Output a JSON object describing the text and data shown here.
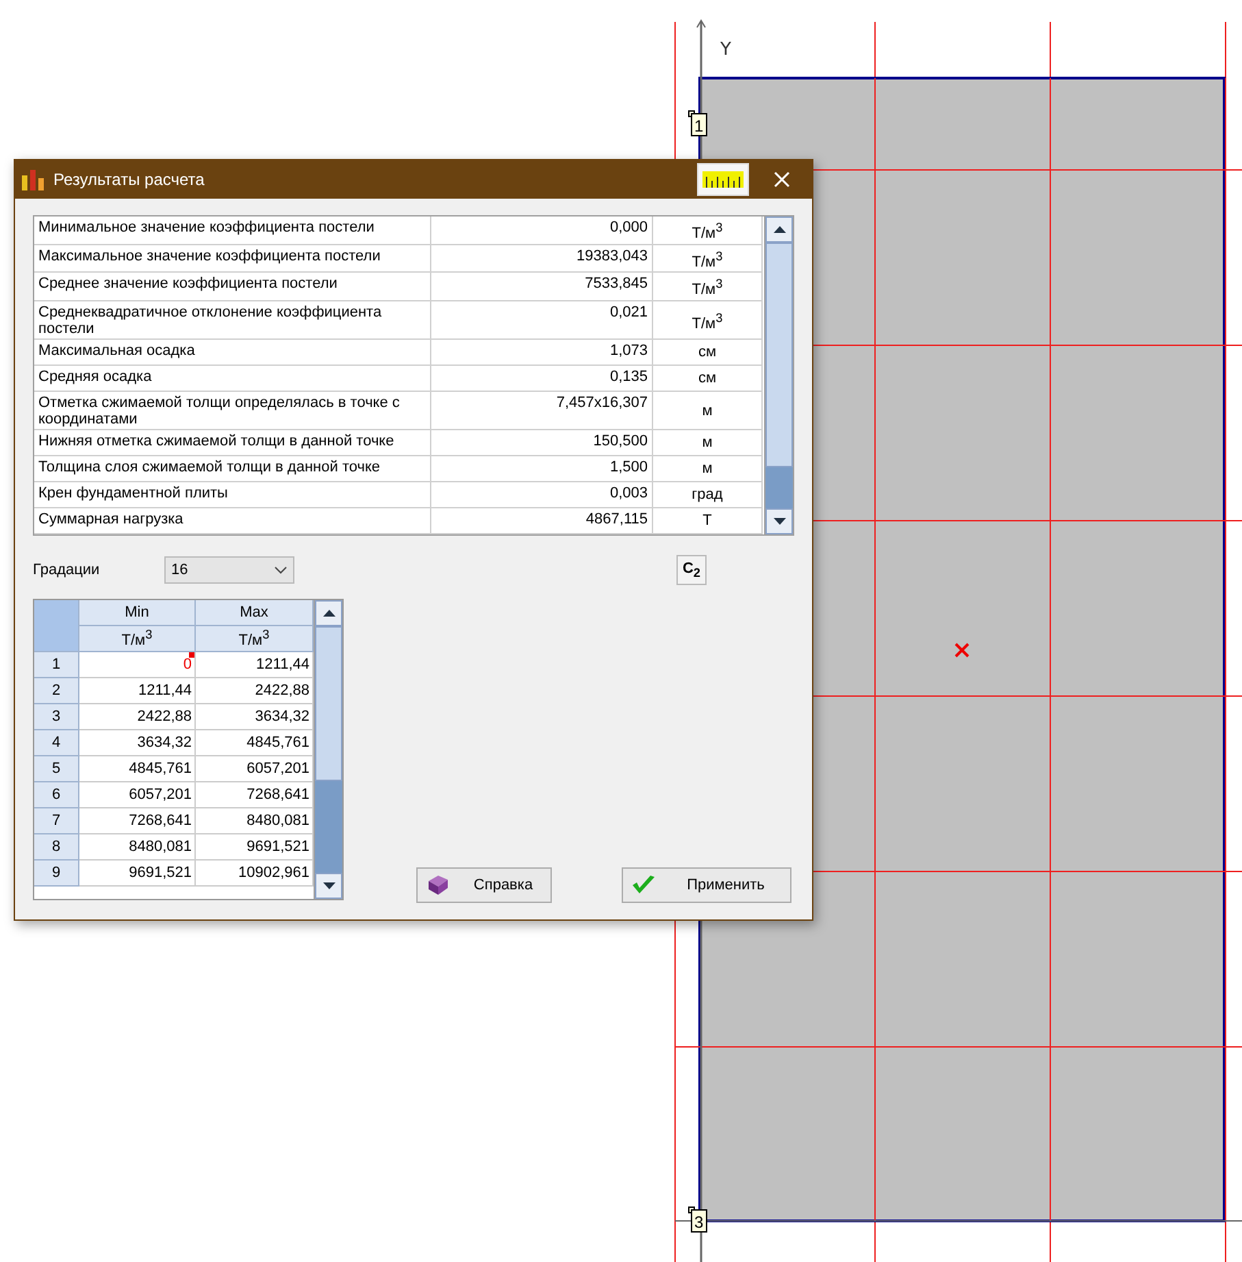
{
  "canvas": {
    "axis_label": "Y",
    "nodes": [
      "1",
      "3"
    ]
  },
  "dialog": {
    "title": "Результаты расчета",
    "results": [
      {
        "name": "Минимальное значение коэффициента постели",
        "value": "0,000",
        "unit": "Т/м$^{3}$"
      },
      {
        "name": "Максимальное значение коэффициента постели",
        "value": "19383,043",
        "unit": "Т/м$^{3}$"
      },
      {
        "name": "Среднее значение коэффициента постели",
        "value": "7533,845",
        "unit": "Т/м$^{3}$"
      },
      {
        "name": "Среднеквадратичное отклонение коэффициента постели",
        "value": "0,021",
        "unit": "Т/м$^{3}$"
      },
      {
        "name": "Максимальная осадка",
        "value": "1,073",
        "unit": "см"
      },
      {
        "name": "Средняя осадка",
        "value": "0,135",
        "unit": "см"
      },
      {
        "name": "Отметка сжимаемой толщи определялась в точке с координатами",
        "value": "7,457x16,307",
        "unit": "м"
      },
      {
        "name": "Нижняя отметка сжимаемой толщи в данной точке",
        "value": "150,500",
        "unit": "м"
      },
      {
        "name": "Толщина слоя сжимаемой толщи в данной точке",
        "value": "1,500",
        "unit": "м"
      },
      {
        "name": "Крен фундаментной плиты",
        "value": "0,003",
        "unit": "град"
      },
      {
        "name": "Суммарная нагрузка",
        "value": "4867,115",
        "unit": "Т"
      }
    ],
    "gradations": {
      "label": "Градации",
      "value": "16"
    },
    "c2_button": "C$_{2}$",
    "grid": {
      "columns": [
        "Min",
        "Max"
      ],
      "units": [
        "Т/м$^{3}$",
        "Т/м$^{3}$"
      ],
      "rows": [
        {
          "index": "1",
          "min": "0",
          "max": "1211,44",
          "flagged": true
        },
        {
          "index": "2",
          "min": "1211,44",
          "max": "2422,88",
          "flagged": false
        },
        {
          "index": "3",
          "min": "2422,88",
          "max": "3634,32",
          "flagged": false
        },
        {
          "index": "4",
          "min": "3634,32",
          "max": "4845,761",
          "flagged": false
        },
        {
          "index": "5",
          "min": "4845,761",
          "max": "6057,201",
          "flagged": false
        },
        {
          "index": "6",
          "min": "6057,201",
          "max": "7268,641",
          "flagged": false
        },
        {
          "index": "7",
          "min": "7268,641",
          "max": "8480,081",
          "flagged": false
        },
        {
          "index": "8",
          "min": "8480,081",
          "max": "9691,521",
          "flagged": false
        },
        {
          "index": "9",
          "min": "9691,521",
          "max": "10902,961",
          "flagged": false
        }
      ]
    },
    "buttons": [
      {
        "kind": "help",
        "label": "Справка"
      },
      {
        "kind": "apply",
        "label": "Применить"
      }
    ]
  }
}
